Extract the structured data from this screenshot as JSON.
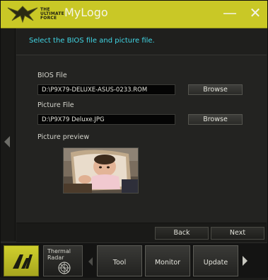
{
  "window": {
    "title": "MyLogo",
    "brand_lines": [
      "THE",
      "ULTIMATE",
      "FORCE"
    ],
    "minimize_glyph": "—",
    "close_glyph": "✕"
  },
  "instruction": "Select the BIOS file and picture file.",
  "bios": {
    "label": "BIOS File",
    "value": "D:\\P9X79-DELUXE-ASUS-0233.ROM",
    "browse": "Browse"
  },
  "picture": {
    "label": "Picture File",
    "value": "D:\\P9X79 Deluxe.JPG",
    "browse": "Browse"
  },
  "preview": {
    "label": "Picture preview"
  },
  "nav": {
    "back": "Back",
    "next": "Next"
  },
  "dock": {
    "thermal_label": "Thermal Radar",
    "tabs": [
      "Tool",
      "Monitor",
      "Update"
    ]
  },
  "colors": {
    "accent": "#c9c826",
    "instruction_text": "#41d7e6",
    "background": "#232321"
  },
  "icons": [
    "tuf-logo-icon",
    "minimize-icon",
    "close-icon",
    "left-arrow-icon",
    "ai-suite-icon",
    "radar-icon",
    "right-arrow-icon"
  ]
}
